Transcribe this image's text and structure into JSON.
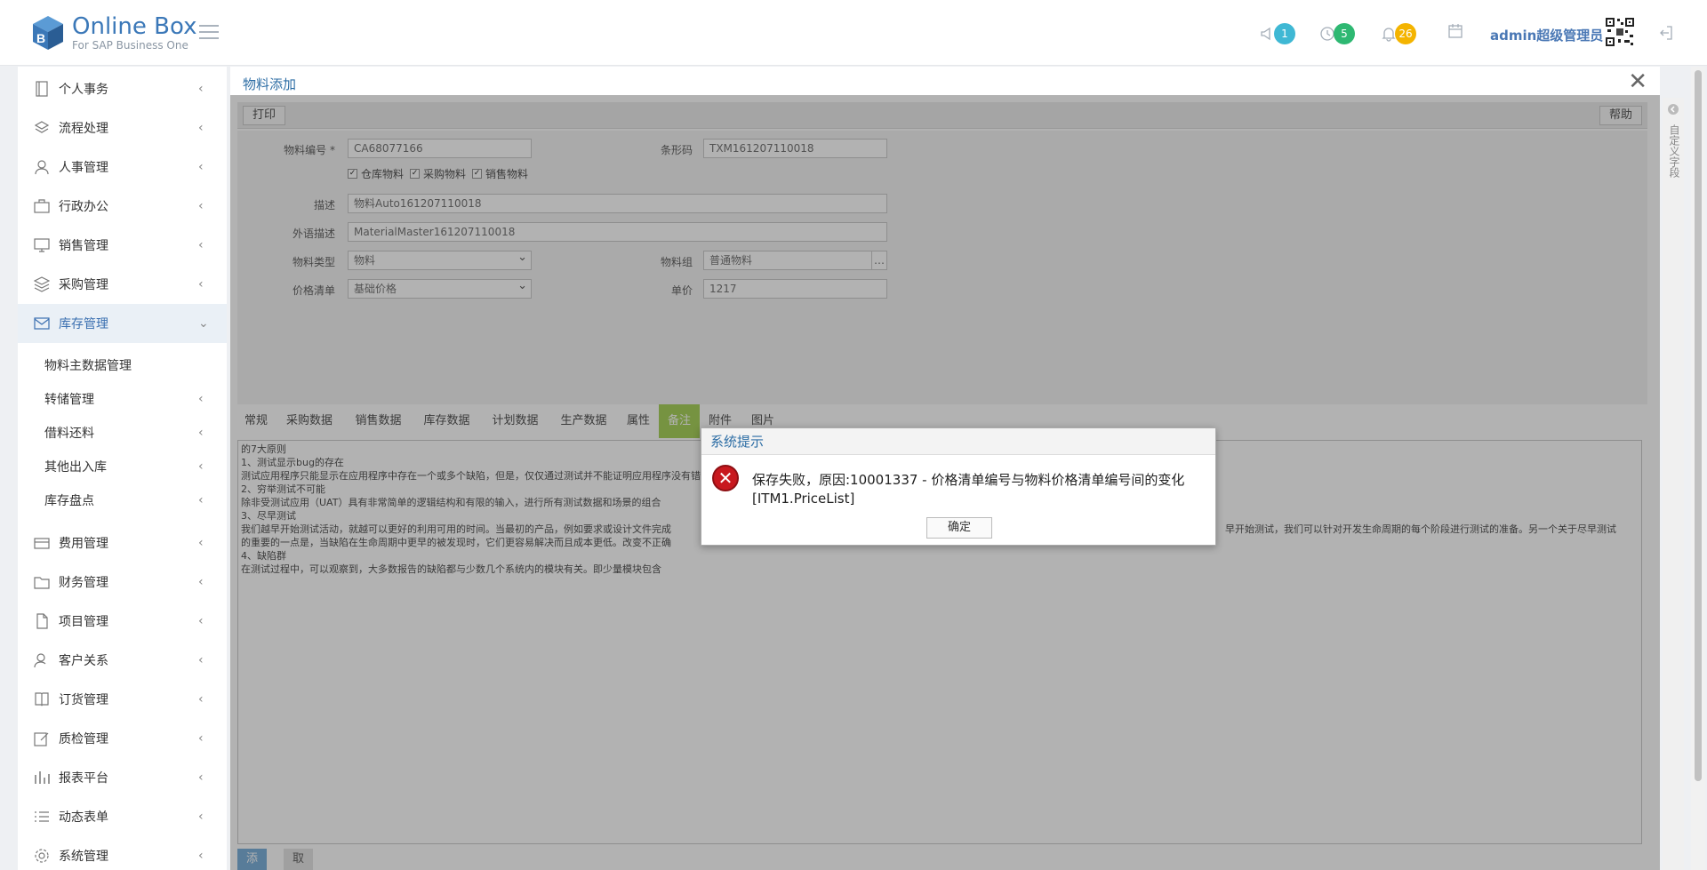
{
  "header": {
    "app_title": "Online Box",
    "app_subtitle": "For SAP Business One",
    "notifications": [
      {
        "icon": "megaphone-icon",
        "count": "1",
        "color": "#3fb8d4"
      },
      {
        "icon": "clock-icon",
        "count": "5",
        "color": "#2eb872"
      },
      {
        "icon": "bell-icon",
        "count": "26",
        "color": "#f4b400"
      }
    ],
    "calendar_icon": "calendar-icon",
    "user_name": "admin超级管理员",
    "logout_icon": "logout-icon"
  },
  "sidebar": {
    "items": [
      {
        "label": "个人事务",
        "icon": "notebook-icon"
      },
      {
        "label": "流程处理",
        "icon": "layers-icon"
      },
      {
        "label": "人事管理",
        "icon": "person-icon"
      },
      {
        "label": "行政办公",
        "icon": "briefcase-icon"
      },
      {
        "label": "销售管理",
        "icon": "monitor-icon"
      },
      {
        "label": "采购管理",
        "icon": "stack-icon"
      },
      {
        "label": "库存管理",
        "icon": "inbox-icon"
      },
      {
        "label": "费用管理",
        "icon": "card-icon"
      },
      {
        "label": "财务管理",
        "icon": "folder-icon"
      },
      {
        "label": "项目管理",
        "icon": "document-icon"
      },
      {
        "label": "客户关系",
        "icon": "customer-icon"
      },
      {
        "label": "订货管理",
        "icon": "book-icon"
      },
      {
        "label": "质检管理",
        "icon": "edit-icon"
      },
      {
        "label": "报表平台",
        "icon": "chart-icon"
      },
      {
        "label": "动态表单",
        "icon": "list-icon"
      },
      {
        "label": "系统管理",
        "icon": "gear-icon"
      }
    ],
    "subitems": [
      {
        "label": "物料主数据管理"
      },
      {
        "label": "转储管理"
      },
      {
        "label": "借料还料"
      },
      {
        "label": "其他出入库"
      },
      {
        "label": "库存盘点"
      }
    ]
  },
  "main": {
    "title": "物料添加",
    "print_label": "打印",
    "help_label": "帮助",
    "form": {
      "item_code_label": "物料编号",
      "item_code_value": "CA68077166",
      "barcode_label": "条形码",
      "barcode_value": "TXM161207110018",
      "checks": [
        "仓库物料",
        "采购物料",
        "销售物料"
      ],
      "desc_label": "描述",
      "desc_value": "物料Auto161207110018",
      "foreign_desc_label": "外语描述",
      "foreign_desc_value": "MaterialMaster161207110018",
      "item_type_label": "物料类型",
      "item_type_value": "物料",
      "item_group_label": "物料组",
      "item_group_value": "普通物料",
      "price_list_label": "价格清单",
      "price_list_value": "基础价格",
      "unit_price_label": "单价",
      "unit_price_value": "1217"
    },
    "tabs": [
      "常规",
      "采购数据",
      "销售数据",
      "库存数据",
      "计划数据",
      "生产数据",
      "属性",
      "备注",
      "附件",
      "图片"
    ],
    "active_tab": "备注",
    "notes": [
      "的7大原则",
      "1、测试显示bug的存在",
      "测试应用程序只能显示在应用程序中存在一个或多个缺陷，但是，仅仅通过测试并不能证明应用程序没有错误。因此，设计测试用例使其尽可能多的找到缺陷是很重要的。",
      "2、穷举测试不可能",
      "除非受测试应用（UAT）具有非常简单的逻辑结构和有限的输入，进行所有测试数据和场景的组合",
      "3、尽早测试",
      "我们越早开始测试活动，就越可以更好的利用可用的时间。当最初的产品，例如要求或设计文件完成",
      "的重要的一点是，当缺陷在生命周期中更早的被发现时，它们更容易解决而且成本更低。改变不正确",
      "4、缺陷群",
      "在测试过程中，可以观察到，大多数报告的缺陷都与少数几个系统内的模块有关。即少量模块包含"
    ],
    "notes_right_fragment": "早开始测试，我们可以针对开发生命周期的每个阶段进行测试的准备。另一个关于尽早测试",
    "add_label": "添加",
    "cancel_label": "取消",
    "custom_field_label": "自定义字段"
  },
  "dialog": {
    "title": "系统提示",
    "message": "保存失败，原因:10001337 - 价格清单编号与物料价格清单编号间的变化 [ITM1.PriceList]",
    "ok_label": "确定"
  }
}
